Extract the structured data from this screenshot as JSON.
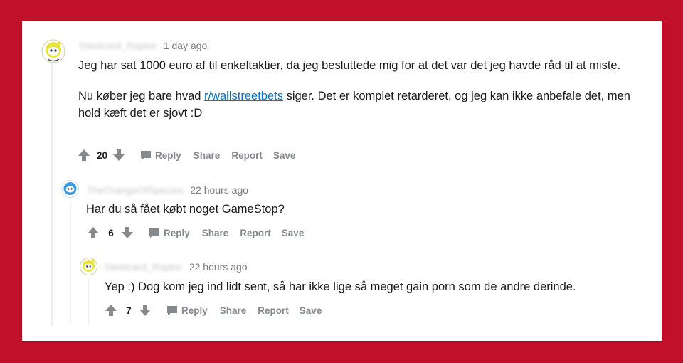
{
  "comments": [
    {
      "username": "Steelcard_Raptor",
      "time": "1 day ago",
      "paragraphs": [
        "Jeg har sat 1000 euro af til enkeltaktier, da jeg besluttede mig for at det var det jeg havde råd til at miste.",
        ""
      ],
      "para2_prefix": "Nu køber jeg bare hvad ",
      "link": "r/wallstreetbets",
      "para2_suffix": " siger. Det er komplet retarderet, og jeg kan ikke anbefale det, men hold kæft det er sjovt :D",
      "score": "20",
      "actions": {
        "reply": "Reply",
        "share": "Share",
        "report": "Report",
        "save": "Save"
      }
    },
    {
      "username": "TheOrangeOfSpecies",
      "time": "22 hours ago",
      "text": "Har du så fået købt noget GameStop?",
      "score": "6",
      "actions": {
        "reply": "Reply",
        "share": "Share",
        "report": "Report",
        "save": "Save"
      }
    },
    {
      "username": "Steelcard_Raptor",
      "time": "22 hours ago",
      "text": "Yep :) Dog kom jeg ind lidt sent, så har ikke lige så meget gain porn som de andre derinde.",
      "score": "7",
      "actions": {
        "reply": "Reply",
        "share": "Share",
        "report": "Report",
        "save": "Save"
      }
    }
  ],
  "colors": {
    "background": "#c0102a",
    "link": "#0079d3",
    "avatar_yellow": "#e8e43c",
    "avatar_blue": "#3b9be0"
  }
}
